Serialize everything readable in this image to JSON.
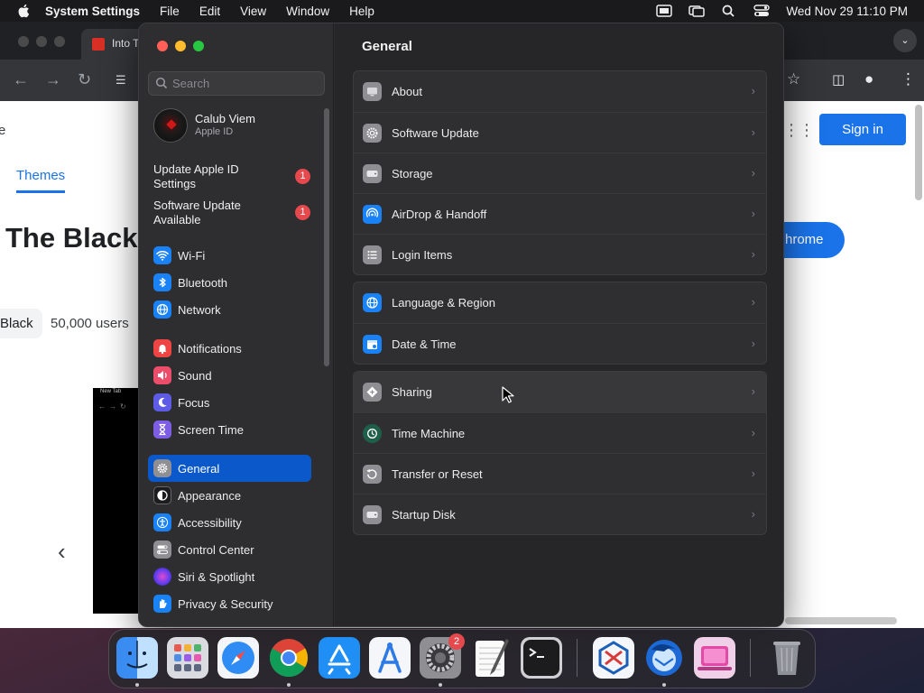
{
  "menubar": {
    "app_name": "System Settings",
    "menus": [
      "File",
      "Edit",
      "View",
      "Window",
      "Help"
    ],
    "clock": "Wed Nov 29  11:10 PM"
  },
  "browser": {
    "tab_title": "Into T",
    "page": {
      "frag_e": "e",
      "themes_tab": "Themes",
      "title_fragment": "The Black",
      "pill_fragment": "Black",
      "users": "50,000 users",
      "sign_in": "Sign in",
      "add_to_chrome_fragment": "hrome",
      "preview_tab": "New Tab"
    }
  },
  "settings": {
    "search_placeholder": "Search",
    "account": {
      "name": "Calub Viem",
      "subtitle": "Apple ID"
    },
    "notices": [
      {
        "label": "Update Apple ID Settings",
        "badge": "1"
      },
      {
        "label": "Software Update Available",
        "badge": "1"
      }
    ],
    "sidebar_items": [
      {
        "label": "Wi-Fi",
        "icon": "wifi-icon",
        "color": "#1a82f7"
      },
      {
        "label": "Bluetooth",
        "icon": "bluetooth-icon",
        "color": "#1a82f7"
      },
      {
        "label": "Network",
        "icon": "globe-icon",
        "color": "#1a82f7"
      },
      {
        "label": "Notifications",
        "icon": "bell-icon",
        "color": "#ef4444"
      },
      {
        "label": "Sound",
        "icon": "speaker-icon",
        "color": "#ec4d6a"
      },
      {
        "label": "Focus",
        "icon": "moon-icon",
        "color": "#5e5ce6"
      },
      {
        "label": "Screen Time",
        "icon": "hourglass-icon",
        "color": "#7d5ce6"
      },
      {
        "label": "General",
        "icon": "gear-icon",
        "color": "#8e8e93"
      },
      {
        "label": "Appearance",
        "icon": "appearance-icon",
        "color": "#1c1c1e"
      },
      {
        "label": "Accessibility",
        "icon": "accessibility-icon",
        "color": "#1a82f7"
      },
      {
        "label": "Control Center",
        "icon": "toggles-icon",
        "color": "#8e8e93"
      },
      {
        "label": "Siri & Spotlight",
        "icon": "siri-icon",
        "color": "#7a3cf0"
      },
      {
        "label": "Privacy & Security",
        "icon": "hand-icon",
        "color": "#1a82f7"
      }
    ],
    "active_item": "General",
    "content_title": "General",
    "groups": [
      [
        {
          "label": "About",
          "icon": "display-icon"
        },
        {
          "label": "Software Update",
          "icon": "gear-badge-icon"
        },
        {
          "label": "Storage",
          "icon": "drive-icon"
        },
        {
          "label": "AirDrop & Handoff",
          "icon": "airdrop-icon"
        },
        {
          "label": "Login Items",
          "icon": "list-icon"
        }
      ],
      [
        {
          "label": "Language & Region",
          "icon": "globe-icon"
        },
        {
          "label": "Date & Time",
          "icon": "calendar-icon"
        }
      ],
      [
        {
          "label": "Sharing",
          "icon": "sharing-icon"
        },
        {
          "label": "Time Machine",
          "icon": "clock-icon"
        },
        {
          "label": "Transfer or Reset",
          "icon": "reset-icon"
        },
        {
          "label": "Startup Disk",
          "icon": "disk-icon"
        }
      ]
    ]
  },
  "dock": {
    "apps": [
      "Finder",
      "Launchpad",
      "Safari",
      "Chrome",
      "App Store",
      "Xcode Instruments",
      "System Settings",
      "TextEdit",
      "Terminal",
      "Virtual Box",
      "Thunderbird",
      "CleanMyMac",
      "Trash"
    ],
    "system_settings_badge": "2"
  }
}
